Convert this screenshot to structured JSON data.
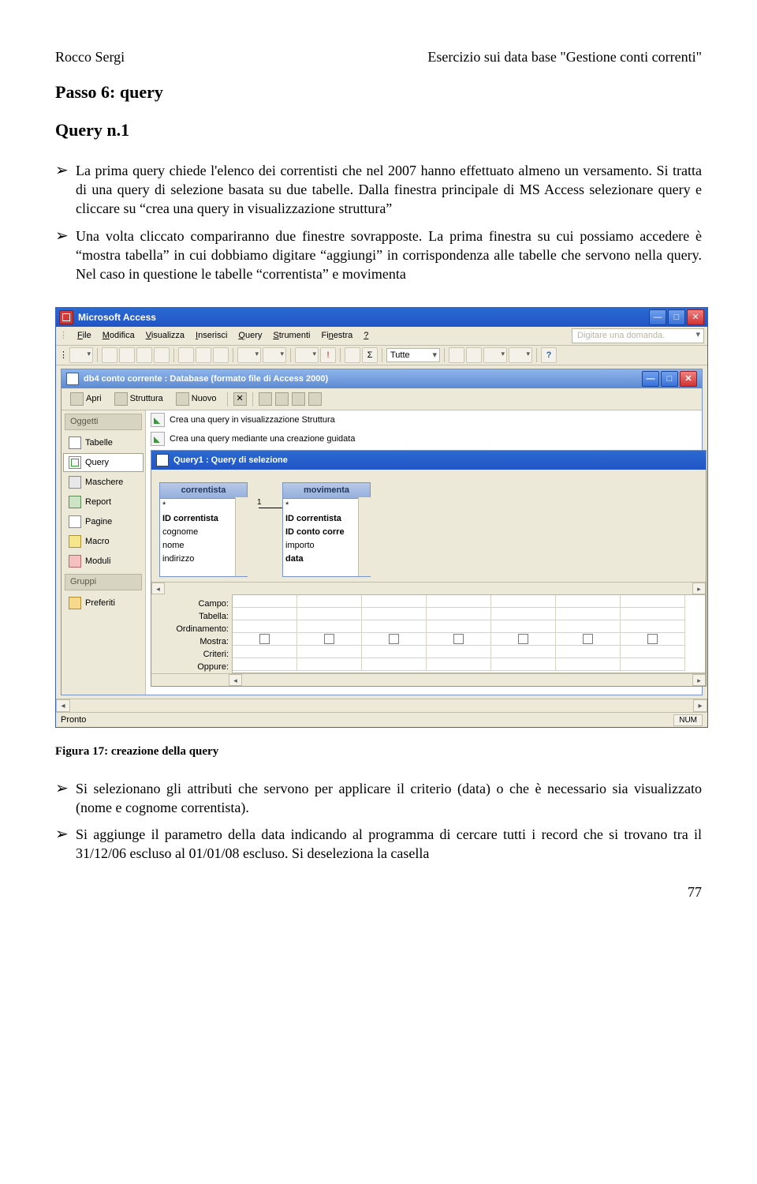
{
  "header": {
    "author": "Rocco Sergi",
    "docTitle": "Esercizio sui data base \"Gestione conti correnti\""
  },
  "passo": "Passo 6: query",
  "queryH": "Query n.1",
  "bullets": {
    "b1": "La prima query chiede l'elenco dei correntisti che nel 2007 hanno effettuato almeno un versamento. Si tratta di una query di selezione basata su due tabelle. Dalla finestra principale di MS Access selezionare query e cliccare su “crea una query in visualizzazione struttura”",
    "b2": "Una volta cliccato compariranno due finestre sovrapposte. La prima finestra su cui possiamo accedere è “mostra tabella” in cui dobbiamo digitare “aggiungi” in corrispondenza alle tabelle che servono nella query. Nel caso in questione le tabelle “correntista” e movimenta",
    "b3": "Si selezionano gli attributi che servono  per applicare il criterio (data) o che è necessario sia visualizzato (nome e cognome correntista).",
    "b4": "Si aggiunge il parametro della data indicando al programma di cercare tutti i record che si trovano tra il 31/12/06 escluso al 01/01/08 escluso. Si deseleziona la casella"
  },
  "caption": "Figura 17: creazione della query",
  "page": "77",
  "app": {
    "title": "Microsoft Access",
    "menu": [
      "File",
      "Modifica",
      "Visualizza",
      "Inserisci",
      "Query",
      "Strumenti",
      "Finestra",
      "?"
    ],
    "askBox": "Digitare una domanda.",
    "toolbarCombo": "Tutte",
    "dbTitle": "db4 conto corrente : Database (formato file di Access 2000)",
    "dbToolbar": {
      "apri": "Apri",
      "struttura": "Struttura",
      "nuovo": "Nuovo"
    },
    "side": {
      "oggetti": "Oggetti",
      "items": [
        "Tabelle",
        "Query",
        "Maschere",
        "Report",
        "Pagine",
        "Macro",
        "Moduli"
      ],
      "gruppi": "Gruppi",
      "preferiti": "Preferiti"
    },
    "creat": {
      "r1": "Crea una query in visualizzazione Struttura",
      "r2": "Crea una query mediante una creazione guidata"
    },
    "qwin": {
      "title": "Query1 : Query di selezione",
      "t1": {
        "name": "correntista",
        "fields": [
          "*",
          "ID correntista",
          "cognome",
          "nome",
          "indirizzo"
        ]
      },
      "t2": {
        "name": "movimenta",
        "fields": [
          "*",
          "ID correntista",
          "ID conto corre",
          "importo",
          "data"
        ]
      }
    },
    "qbeLabels": [
      "Campo:",
      "Tabella:",
      "Ordinamento:",
      "Mostra:",
      "Criteri:",
      "Oppure:"
    ],
    "status": {
      "left": "Pronto",
      "num": "NUM"
    }
  }
}
